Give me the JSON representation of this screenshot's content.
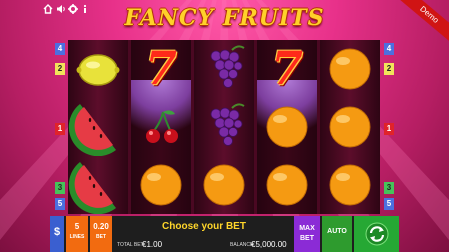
{
  "game": {
    "title": "FANCY FRUITS",
    "demo_label": "Demo"
  },
  "top_icons": [
    "home-icon",
    "sound-icon",
    "settings-icon",
    "info-icon"
  ],
  "paylines": {
    "left": [
      "4",
      "2",
      "1",
      "3",
      "5"
    ],
    "right": [
      "4",
      "2",
      "1",
      "3",
      "5"
    ]
  },
  "reels": [
    [
      "lemon",
      "watermelon",
      "watermelon"
    ],
    [
      "seven",
      "cherries",
      "orange"
    ],
    [
      "grapes",
      "grapes",
      "orange"
    ],
    [
      "seven",
      "orange",
      "orange"
    ],
    [
      "orange",
      "orange",
      "orange"
    ]
  ],
  "bottom_bar": {
    "lines_value": "5",
    "lines_label": "LINES",
    "bet_value": "0.20",
    "bet_label": "BET",
    "message": "Choose your BET",
    "total_bet_label": "TOTAL BET",
    "total_bet_value": "€1.00",
    "balance_label": "BALANCE",
    "balance_value": "€5,000.00",
    "max_bet_label": "MAX BET",
    "auto_label": "AUTO",
    "paytable_label": "$",
    "spin_icon": "spin-arrows-icon"
  },
  "colors": {
    "background": "#e8318a",
    "title": "#ffd12a",
    "max_bet_button": "#8b2bd6",
    "auto_button": "#2e9b2e",
    "spin_button": "#26a834",
    "lines_button": "#f26b10"
  }
}
